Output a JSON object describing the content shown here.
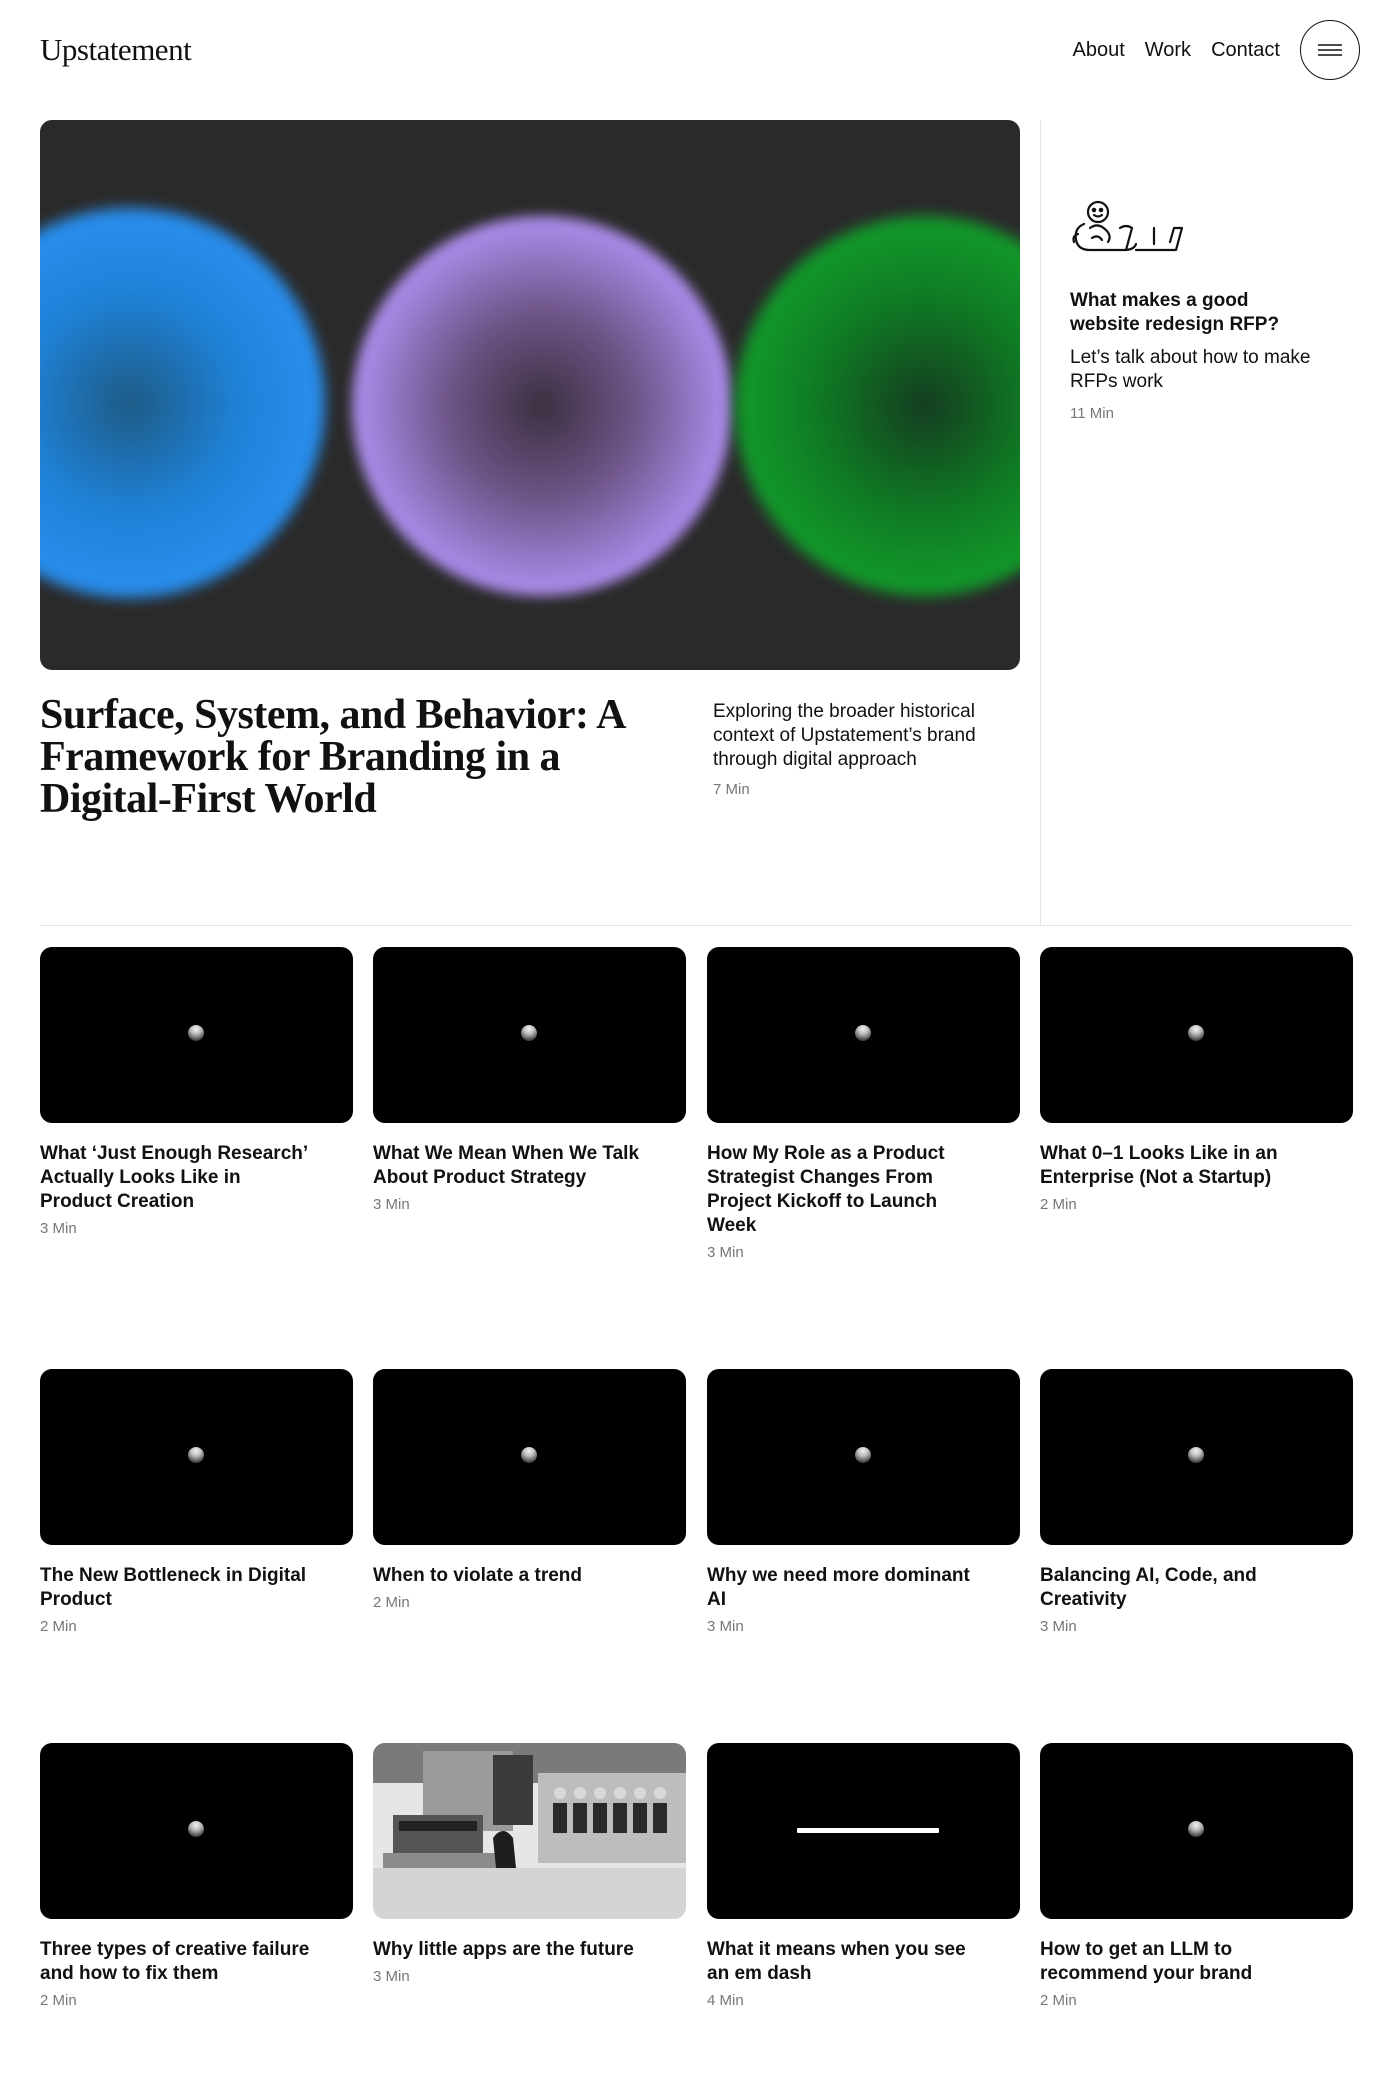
{
  "brand": {
    "logo": "Upstatement"
  },
  "nav": {
    "about": "About",
    "work": "Work",
    "contact": "Contact"
  },
  "hero": {
    "title": "Surface, System, and Behavior: A Framework for Branding in a Digital-First World",
    "description": "Exploring the broader historical context of Upstatement’s brand through digital approach",
    "read_time": "7 Min"
  },
  "side_feature": {
    "title": "What makes a good website redesign RFP?",
    "description": "Let’s talk about how to make RFPs work",
    "read_time": "11 Min"
  },
  "articles": [
    {
      "title": "What ‘Just Enough Research’ Actually Looks Like in Product Creation",
      "read_time": "3 Min"
    },
    {
      "title": "What We Mean When We Talk About Product Strategy",
      "read_time": "3 Min"
    },
    {
      "title": "How My Role as a Product Strategist Changes From Project Kickoff to Launch Week",
      "read_time": "3 Min"
    },
    {
      "title": "What 0–1 Looks Like in an Enterprise (Not a Startup)",
      "read_time": "2 Min"
    },
    {
      "title": "The New Bottleneck in Digital Product",
      "read_time": "2 Min"
    },
    {
      "title": "When to violate a trend",
      "read_time": "2 Min"
    },
    {
      "title": "Why we need more dominant AI",
      "read_time": "3 Min"
    },
    {
      "title": "Balancing AI, Code, and Creativity",
      "read_time": "3 Min"
    },
    {
      "title": "Three types of creative failure and how to fix them",
      "read_time": "2 Min"
    },
    {
      "title": "Why little apps are the future",
      "read_time": "3 Min"
    },
    {
      "title": "What it means when you see an em dash",
      "read_time": "4 Min"
    },
    {
      "title": "How to get an LLM to recommend your brand",
      "read_time": "2 Min"
    }
  ],
  "icons": {
    "menu": "hamburger-menu-icon",
    "side_illustration": "character-illustration",
    "thumbnail_dot": "sphere-dot-icon"
  },
  "colors": {
    "background": "#ffffff",
    "text": "#111111",
    "muted": "#777777",
    "divider": "#e3e3e3",
    "thumbnail": "#000000",
    "hero_bg": "#2a2a2a"
  }
}
